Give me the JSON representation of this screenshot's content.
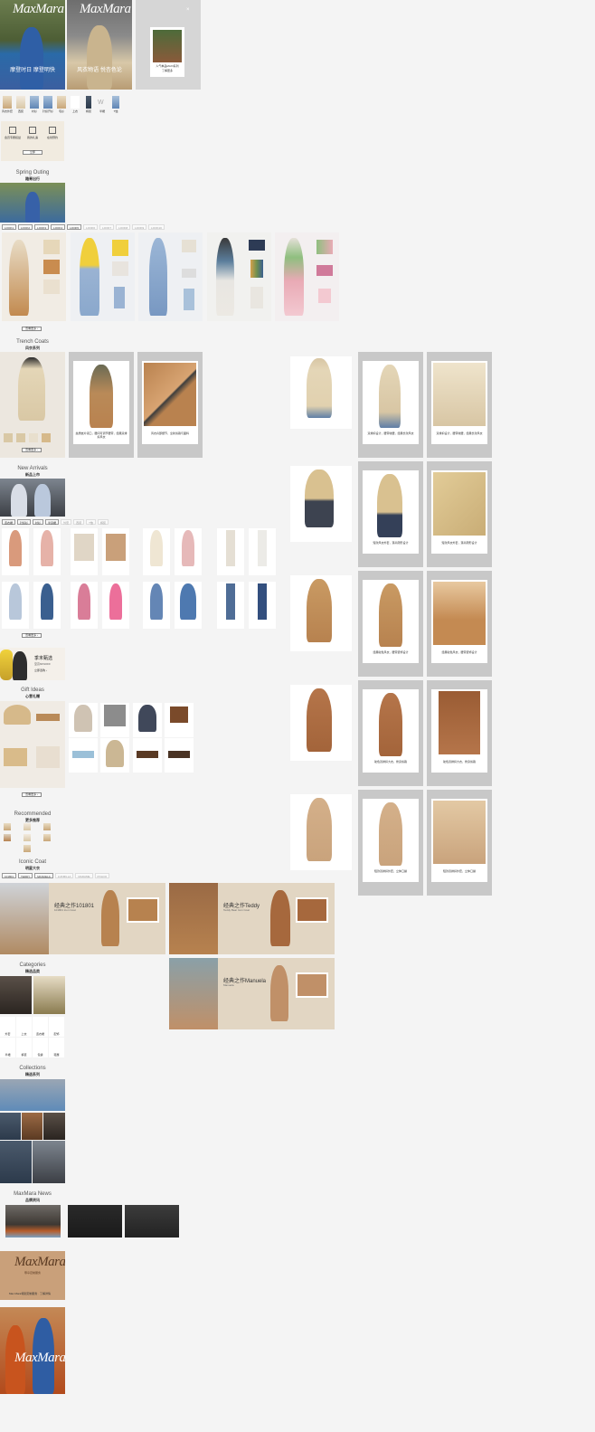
{
  "brand": {
    "logo": "MaxMara"
  },
  "hero": {
    "slides": [
      {
        "caption": "摩登时日 摩登明快"
      },
      {
        "caption": "风衣物语 悦杏色论"
      }
    ],
    "promo_card": {
      "caption": "人气单品MAXI系列",
      "link": "了解更多"
    }
  },
  "categories_strip": [
    "风衣外套",
    "西装",
    "衬衫",
    "针织开衫",
    "毛衫",
    "上衣",
    "裤装",
    "半裙",
    "T恤"
  ],
  "service_grid": {
    "items": [
      {
        "label": "会员专属权益"
      },
      {
        "label": "我的礼遇"
      },
      {
        "label": "在线预约"
      }
    ],
    "cta": "立即"
  },
  "spring_outing": {
    "title": "Spring Outing",
    "subtitle": "踏青出行"
  },
  "look_tabs": [
    "LOOK1",
    "LOOK2",
    "LOOK3",
    "LOOK4",
    "LOOK5",
    "LOOK6",
    "LOOK7",
    "LOOK8",
    "LOOK9",
    "LOOK10"
  ],
  "view_more": "查看更多 ›",
  "trench": {
    "title": "Trench Coats",
    "subtitle": "风衣系列"
  },
  "new_arrivals": {
    "title": "New Arrivals",
    "subtitle": "新品上市"
  },
  "arrival_tabs": [
    "连衣裙",
    "针织衫",
    "衬衫",
    "半身裙",
    "外套",
    "西装",
    "T恤",
    "裤装"
  ],
  "seasonal": {
    "line1": "季末甄选",
    "line2": "至高60%OFF",
    "link": "立即选购 ›"
  },
  "gift": {
    "title": "Gift Ideas",
    "subtitle": "心意礼赠"
  },
  "recommended": {
    "title": "Recommended",
    "subtitle": "更多推荐"
  },
  "iconic": {
    "title": "Iconic Coat",
    "subtitle": "明星大衣"
  },
  "iconic_tabs": [
    "101801",
    "TEDDY",
    "MANUELA",
    "LUDMILLA",
    "MADAME",
    "POLDO"
  ],
  "iconic_cards": [
    {
      "title": "经典之作101801",
      "sub": "101801 Icon Coat"
    },
    {
      "title": "经典之作Teddy",
      "sub": "Teddy Bear Icon Coat"
    },
    {
      "title": "经典之作Manuela",
      "sub": "Manuela"
    }
  ],
  "categories": {
    "title": "Categories",
    "subtitle": "精选品类",
    "items": [
      "外套",
      "上衣",
      "连衣裙",
      "配饰",
      "半裙",
      "裤装",
      "包袋",
      "鞋履"
    ]
  },
  "collections": {
    "title": "Collections",
    "subtitle": "精选系列"
  },
  "news": {
    "title": "MaxMara News",
    "subtitle": "品牌资讯"
  },
  "footer": {
    "banner": "Max Mara特别定制服务 · 了解详情",
    "sub": "尊享定制服务"
  },
  "trench_captions": [
    "丝质嵌片领口，腰间可调节腰带，经典双排扣风衣",
    "风衣肩部细节，全新剪裁与面料",
    "双排扣设计，腰带收腰，经典长款风衣",
    "短款风衣外套，落肩廓形设计",
    "经典驼色风衣，腰带装饰设计",
    "驼色双排扣大衣，修身剪裁",
    "短款双排扣外套，立体口袋"
  ],
  "colors": {
    "bg": "#f4f4f4",
    "camel": "#b7824f",
    "frame": "#c8c8c8"
  }
}
